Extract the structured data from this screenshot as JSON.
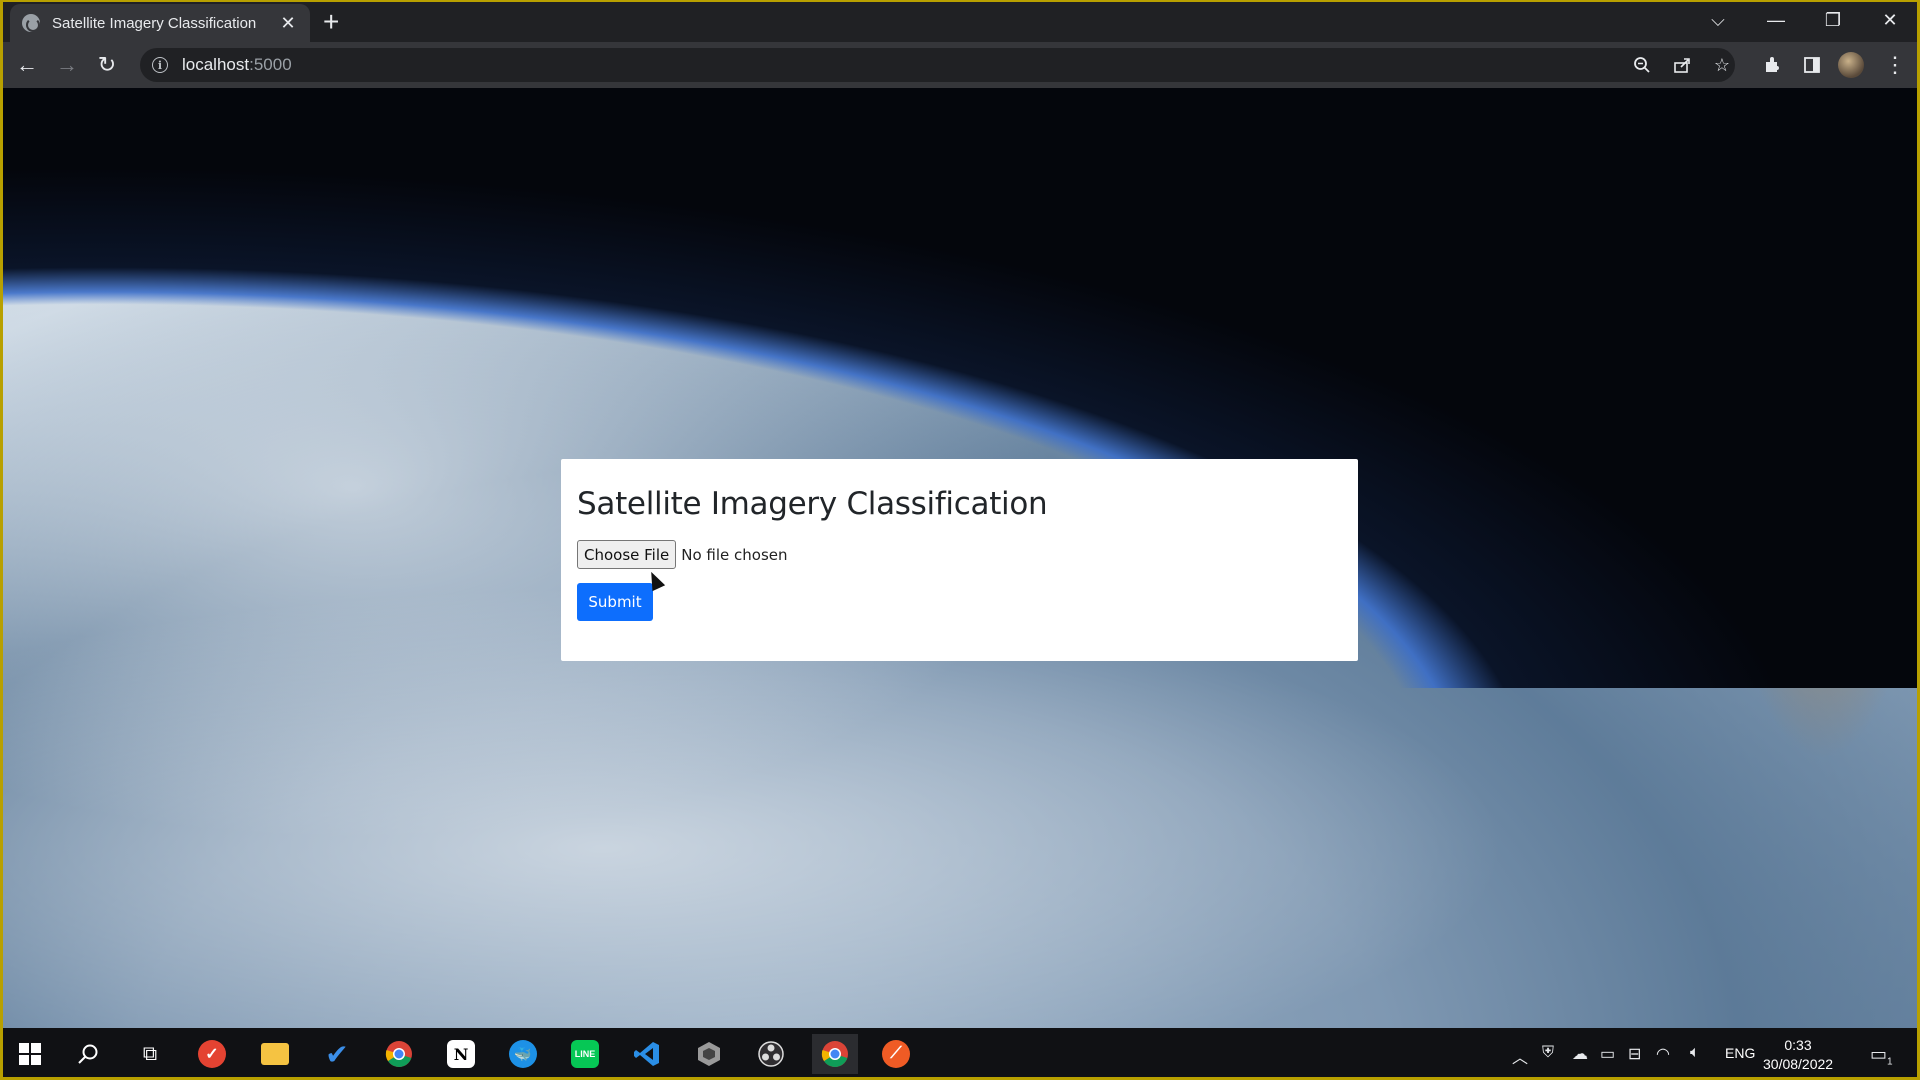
{
  "browser": {
    "tab_title": "Satellite Imagery Classification",
    "tab_close": "✕",
    "new_tab": "+",
    "url_host": "localhost",
    "url_port": ":5000",
    "window_controls": {
      "dropdown": "⌵",
      "minimize": "—",
      "restore": "❐",
      "close": "✕"
    },
    "toolbar_icons": [
      "zoom-icon",
      "share-icon",
      "bookmark-star-icon",
      "extensions-icon",
      "side-panel-icon",
      "profile-avatar",
      "menu-icon"
    ]
  },
  "form": {
    "heading": "Satellite Imagery Classification",
    "choose_file_label": "Choose File",
    "file_status": "No file chosen",
    "submit_label": "Submit"
  },
  "taskbar": {
    "language": "ENG",
    "time": "0:33",
    "date": "30/08/2022",
    "notification_count": "1",
    "apps": [
      "windows-start",
      "search",
      "task-view",
      "todoist",
      "file-explorer",
      "microsoft-todo",
      "chrome",
      "notion",
      "docker",
      "line",
      "vscode",
      "unity",
      "obs",
      "chrome-active",
      "postman"
    ]
  },
  "colors": {
    "accent": "#0d6efd",
    "tab_bg": "#35363a",
    "titlebar_bg": "#202124",
    "taskbar_bg": "#101114"
  }
}
